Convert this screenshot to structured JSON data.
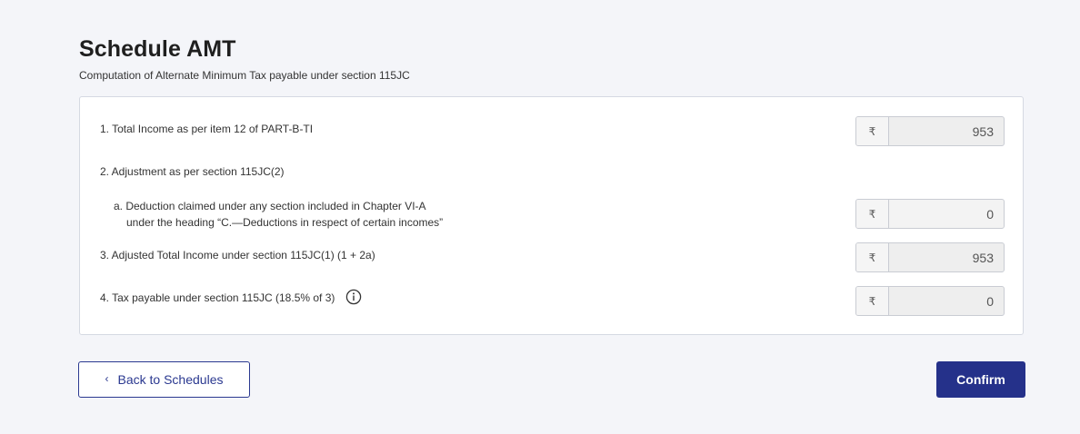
{
  "header": {
    "title": "Schedule AMT",
    "subtitle": "Computation of Alternate Minimum Tax payable under section 115JC"
  },
  "rows": [
    {
      "label": "1. Total Income as per item 12 of PART-B-TI",
      "currency": "₹",
      "value": "953"
    },
    {
      "label": "2. Adjustment as per section 115JC(2)"
    },
    {
      "label_line1": "a. Deduction claimed under any section included in Chapter VI-A",
      "label_line2": "under the heading “C.—Deductions in respect of certain incomes”",
      "currency": "₹",
      "value": "0"
    },
    {
      "label": "3. Adjusted Total Income under section 115JC(1) (1 + 2a)",
      "currency": "₹",
      "value": "953"
    },
    {
      "label": "4. Tax payable under section 115JC (18.5% of 3)",
      "currency": "₹",
      "value": "0",
      "icon": "info-icon"
    }
  ],
  "footer": {
    "back_label": "Back to Schedules",
    "back_icon": "chevron-left-icon",
    "confirm_label": "Confirm"
  },
  "colors": {
    "primary": "#25318a",
    "background": "#f4f5f9"
  }
}
